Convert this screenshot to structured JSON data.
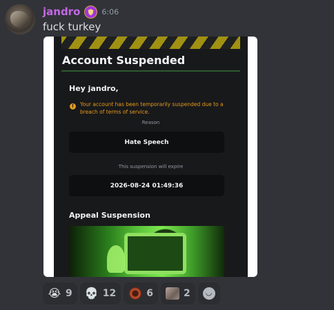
{
  "message": {
    "username": "jandro",
    "timestamp": "6:06",
    "text": "fuck turkey",
    "badge_icon": "shield-crest-icon"
  },
  "embed": {
    "title": "Account Suspended",
    "greeting": "Hey jandro,",
    "warning": "Your account has been temporarily suspended due to a breach of terms of service.",
    "reason_label": "Reason",
    "reason_value": "Hate Speech",
    "expire_label": "This suspension will expire",
    "expire_value": "2026-08-24 01:49:36",
    "appeal_title": "Appeal Suspension"
  },
  "reactions": [
    {
      "emoji": "😭",
      "count": "9"
    },
    {
      "emoji": "💀",
      "count": "12"
    },
    {
      "emoji": "ring-emoji",
      "count": "6"
    },
    {
      "emoji": "custom-image-emoji",
      "count": "2"
    }
  ],
  "colors": {
    "username": "#c468e6",
    "warning": "#e59a1b",
    "background": "#313338"
  }
}
